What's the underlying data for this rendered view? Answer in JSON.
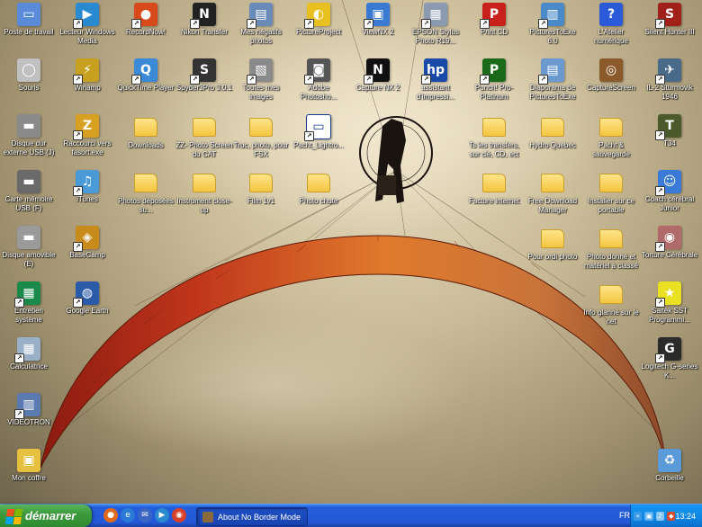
{
  "desktop": {
    "icons": [
      {
        "label": "Poste de travail",
        "icon": "my-computer-icon"
      },
      {
        "label": "Lecteur Windows Media",
        "icon": "windows-media-player-icon"
      },
      {
        "label": "RecordNow!",
        "icon": "recordnow-icon"
      },
      {
        "label": "Nikon Transfer",
        "icon": "nikon-transfer-icon"
      },
      {
        "label": "Mes négatifs photos",
        "icon": "negatives-document-icon"
      },
      {
        "label": "PictureProject",
        "icon": "pictureproject-icon"
      },
      {
        "label": "ViewNX 2",
        "icon": "viewnx-icon"
      },
      {
        "label": "EPSON Stylus Photo R19...",
        "icon": "printer-icon"
      },
      {
        "label": "Print CD",
        "icon": "print-cd-icon"
      },
      {
        "label": "PicturesToExe 6.0",
        "icon": "picturestoexe-icon"
      },
      {
        "label": "L'Atelier numérique",
        "icon": "help-icon"
      },
      {
        "label": "Silent Hunter III",
        "icon": "silent-hunter-icon"
      },
      {
        "label": "Souris",
        "icon": "mouse-icon"
      },
      {
        "label": "Winamp",
        "icon": "winamp-icon"
      },
      {
        "label": "QuickTime Player",
        "icon": "quicktime-icon"
      },
      {
        "label": "Spyder3Pro 3.0.1",
        "icon": "spyder-icon"
      },
      {
        "label": "Toutes mes images",
        "icon": "images-icon"
      },
      {
        "label": "Adobe Photosho...",
        "icon": "camera-icon"
      },
      {
        "label": "Capture NX 2",
        "icon": "capture-nx-icon"
      },
      {
        "label": "assistant d'impressi...",
        "icon": "hp-icon"
      },
      {
        "label": "Punch! Pro-Platinum",
        "icon": "punch-icon"
      },
      {
        "label": "Diaporama de PicturesToExe",
        "icon": "slideshow-icon"
      },
      {
        "label": "CaptureScreen",
        "icon": "capturescreen-icon"
      },
      {
        "label": "IL-2 Sturmovik 1946",
        "icon": "airplane-icon"
      },
      {
        "label": "Disque dur externe USB (J)",
        "icon": "usb-drive-icon"
      },
      {
        "label": "Raccourci vers fasort.exe",
        "icon": "lightning-icon"
      },
      {
        "label": "Downloads",
        "icon": "folder-icon"
      },
      {
        "label": "ZZ- Photo Screen du CAT",
        "icon": "folder-icon"
      },
      {
        "label": "Truc, photo, pour FSX",
        "icon": "folder-icon"
      },
      {
        "label": "Pacht_Lightro...",
        "icon": "window-icon"
      },
      {
        "label": "Ts les transfers, sur clé, CD, ect",
        "icon": "folder-icon"
      },
      {
        "label": "Hydro Quebec",
        "icon": "folder-icon"
      },
      {
        "label": "Pacht & sauvegarde",
        "icon": "folder-icon"
      },
      {
        "label": "T34",
        "icon": "tank-icon"
      },
      {
        "label": "Carte mémoire USB (F)",
        "icon": "memory-card-icon"
      },
      {
        "label": "iTunes",
        "icon": "itunes-icon"
      },
      {
        "label": "Photos déposées su...",
        "icon": "folder-icon"
      },
      {
        "label": "Instrument close-up",
        "icon": "folder-icon"
      },
      {
        "label": "Film 1v1",
        "icon": "folder-icon"
      },
      {
        "label": "Photo chute",
        "icon": "folder-icon"
      },
      {
        "label": "Facture internet",
        "icon": "folder-icon"
      },
      {
        "label": "Free Download Manager",
        "icon": "folder-icon"
      },
      {
        "label": "Installer sur ce portable",
        "icon": "folder-icon"
      },
      {
        "label": "Coach cérébral Junior",
        "icon": "coach-icon"
      },
      {
        "label": "Disque amovible (E)",
        "icon": "removable-disk-icon"
      },
      {
        "label": "BaseCamp",
        "icon": "basecamp-icon"
      },
      {
        "label": "Pour ordi photo",
        "icon": "folder-icon"
      },
      {
        "label": "Photo donné et matériel à classé",
        "icon": "folder-icon"
      },
      {
        "label": "Torture Cérébrale",
        "icon": "torture-icon"
      },
      {
        "label": "Entretien système",
        "icon": "system-maintenance-icon"
      },
      {
        "label": "Google Earth",
        "icon": "google-earth-icon"
      },
      {
        "label": "Info glanné sur le net",
        "icon": "folder-icon"
      },
      {
        "label": "Saitek SST Programmi...",
        "icon": "saitek-icon"
      },
      {
        "label": "Calculatrice",
        "icon": "calculator-icon"
      },
      {
        "label": "Logitech G-series K...",
        "icon": "logitech-icon"
      },
      {
        "label": "VIDEOTRON",
        "icon": "videotron-icon"
      },
      {
        "label": "Mon coffre",
        "icon": "safe-folder-icon"
      },
      {
        "label": "Corbeille",
        "icon": "recycle-bin-icon"
      }
    ]
  },
  "taskbar": {
    "start_label": "démarrer",
    "quick_launch": [
      "firefox-icon",
      "ie-icon",
      "outlook-icon",
      "media-icon",
      "chrome-icon"
    ],
    "task_label": "About No Border Mode",
    "language": "FR",
    "clock": "13:24"
  },
  "colors": {
    "taskbar_blue": "#245edb",
    "start_green": "#3c9a3c",
    "wing_red": "#c0361c",
    "wing_orange": "#e07a2c"
  }
}
